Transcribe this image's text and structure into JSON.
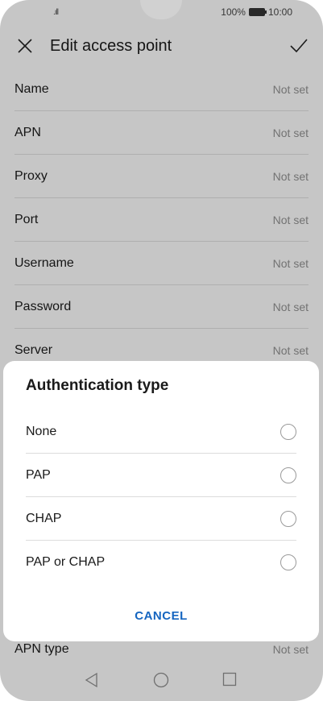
{
  "status": {
    "signal": ".ıll",
    "battery": "100%",
    "time": "10:00"
  },
  "header": {
    "title": "Edit access point"
  },
  "rows": [
    {
      "label": "Name",
      "value": "Not set"
    },
    {
      "label": "APN",
      "value": "Not set"
    },
    {
      "label": "Proxy",
      "value": "Not set"
    },
    {
      "label": "Port",
      "value": "Not set"
    },
    {
      "label": "Username",
      "value": "Not set"
    },
    {
      "label": "Password",
      "value": "Not set"
    },
    {
      "label": "Server",
      "value": "Not set"
    }
  ],
  "apn_type": {
    "label": "APN type",
    "value": "Not set"
  },
  "dialog": {
    "title": "Authentication type",
    "options": [
      "None",
      "PAP",
      "CHAP",
      "PAP or CHAP"
    ],
    "cancel": "CANCEL"
  },
  "colors": {
    "accent": "#1565c0",
    "scrim": "#d0d0d0"
  }
}
